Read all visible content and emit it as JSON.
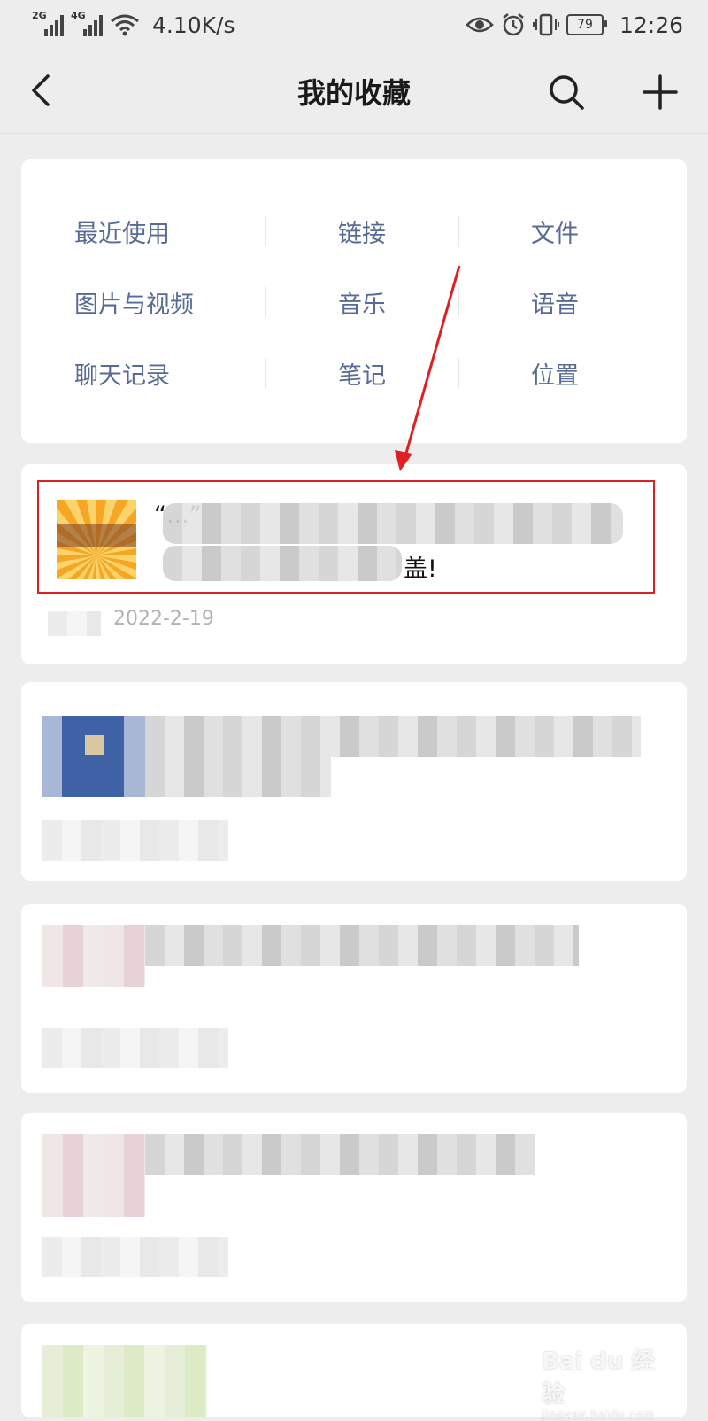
{
  "status_bar": {
    "net_left": "2G",
    "net_right": "4G",
    "speed": "4.10K/s",
    "battery": "79",
    "time": "12:26"
  },
  "nav": {
    "title": "我的收藏"
  },
  "categories": [
    [
      "最近使用",
      "链接",
      "文件"
    ],
    [
      "图片与视频",
      "音乐",
      "语音"
    ],
    [
      "聊天记录",
      "笔记",
      "位置"
    ]
  ],
  "favorites": {
    "first": {
      "title_line1": "“...”",
      "title_line2": "盖!",
      "date": "2022-2-19"
    }
  },
  "watermark": {
    "brand": "Bai du 经验",
    "site": "jingyan.baidu.com"
  }
}
